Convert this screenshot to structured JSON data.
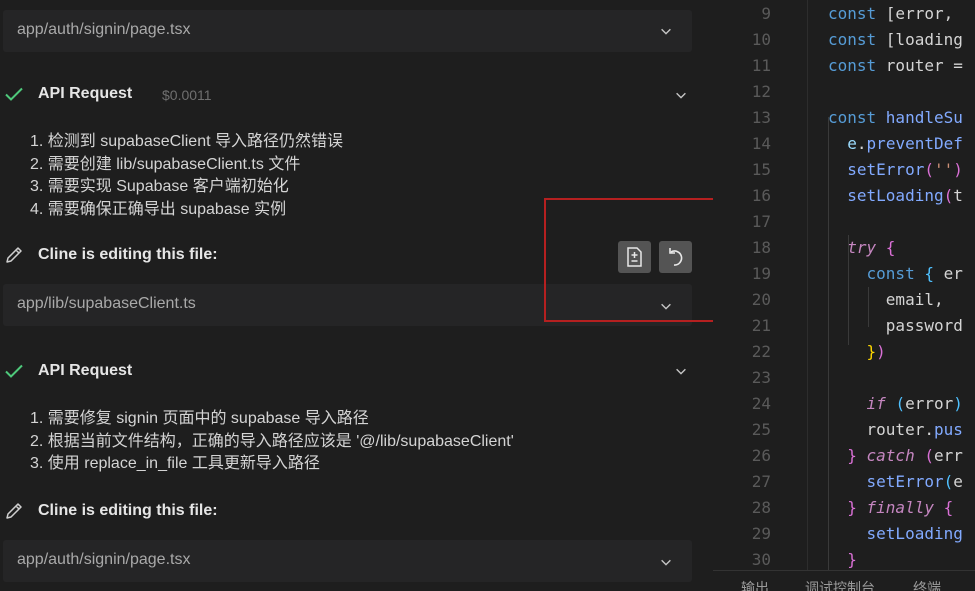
{
  "chat": {
    "top_file": {
      "path": "app/auth/signin/page.tsx"
    },
    "request_1": {
      "title": "API Request",
      "cost": "$0.0011",
      "steps": [
        "1. 检测到 supabaseClient 导入路径仍然错误",
        "2. 需要创建 lib/supabaseClient.ts 文件",
        "3. 需要实现 Supabase 客户端初始化",
        "4. 需要确保正确导出 supabase 实例"
      ]
    },
    "edit_1": {
      "label": "Cline is editing this file:",
      "path": "app/lib/supabaseClient.ts"
    },
    "request_2": {
      "title": "API Request",
      "steps": [
        "1. 需要修复 signin 页面中的 supabase 导入路径",
        "2. 根据当前文件结构，正确的导入路径应该是 '@/lib/supabaseClient'",
        "3. 使用 replace_in_file 工具更新导入路径"
      ]
    },
    "edit_2": {
      "label": "Cline is editing this file:",
      "path": "app/auth/signin/page.tsx"
    },
    "icons": {
      "check": "check-icon",
      "pencil": "pencil-icon",
      "chevron": "chevron-down-icon",
      "diff": "file-diff-icon",
      "undo": "undo-icon"
    }
  },
  "editor": {
    "lines": [
      {
        "n": "9",
        "tokens": [
          [
            "st",
            "const "
          ],
          [
            "pl",
            "[error, "
          ]
        ]
      },
      {
        "n": "10",
        "tokens": [
          [
            "st",
            "const "
          ],
          [
            "pl",
            "[loading"
          ]
        ]
      },
      {
        "n": "11",
        "tokens": [
          [
            "st",
            "const "
          ],
          [
            "pl",
            "router ="
          ]
        ]
      },
      {
        "n": "12",
        "tokens": []
      },
      {
        "n": "13",
        "tokens": [
          [
            "st",
            "const "
          ],
          [
            "fn",
            "handleSu"
          ]
        ]
      },
      {
        "n": "14",
        "tokens": [
          [
            "pr",
            "  e"
          ],
          [
            "pl",
            "."
          ],
          [
            "fn",
            "preventDef"
          ]
        ]
      },
      {
        "n": "15",
        "tokens": [
          [
            "fn",
            "  setError"
          ],
          [
            "br2",
            "("
          ],
          [
            "str",
            "''"
          ],
          [
            "br2",
            ")"
          ]
        ]
      },
      {
        "n": "16",
        "tokens": [
          [
            "fn",
            "  setLoading"
          ],
          [
            "br2",
            "("
          ],
          [
            "pl",
            "t"
          ]
        ]
      },
      {
        "n": "17",
        "tokens": []
      },
      {
        "n": "18",
        "tokens": [
          [
            "kw",
            "  try "
          ],
          [
            "br2",
            "{"
          ]
        ]
      },
      {
        "n": "19",
        "tokens": [
          [
            "st",
            "    const "
          ],
          [
            "br3",
            "{ "
          ],
          [
            "pl",
            "er"
          ]
        ]
      },
      {
        "n": "20",
        "tokens": [
          [
            "pl",
            "      email,"
          ]
        ]
      },
      {
        "n": "21",
        "tokens": [
          [
            "pl",
            "      password"
          ]
        ]
      },
      {
        "n": "22",
        "tokens": [
          [
            "br1",
            "    }"
          ],
          [
            "br2",
            ")"
          ]
        ]
      },
      {
        "n": "23",
        "tokens": []
      },
      {
        "n": "24",
        "tokens": [
          [
            "kw",
            "    if "
          ],
          [
            "br3",
            "("
          ],
          [
            "pl",
            "error"
          ],
          [
            "br3",
            ")"
          ]
        ]
      },
      {
        "n": "25",
        "tokens": [
          [
            "pl",
            "    router."
          ],
          [
            "fn",
            "pus"
          ]
        ]
      },
      {
        "n": "26",
        "tokens": [
          [
            "br2",
            "  } "
          ],
          [
            "kw",
            "catch "
          ],
          [
            "br2",
            "("
          ],
          [
            "pl",
            "err"
          ]
        ]
      },
      {
        "n": "27",
        "tokens": [
          [
            "fn",
            "    setError"
          ],
          [
            "br3",
            "("
          ],
          [
            "pl",
            "e"
          ]
        ]
      },
      {
        "n": "28",
        "tokens": [
          [
            "br2",
            "  } "
          ],
          [
            "kw",
            "finally "
          ],
          [
            "br2",
            "{"
          ]
        ]
      },
      {
        "n": "29",
        "tokens": [
          [
            "fn",
            "    setLoading"
          ]
        ]
      },
      {
        "n": "30",
        "tokens": [
          [
            "br2",
            "  }"
          ]
        ]
      }
    ],
    "bottom_tabs": [
      "输出",
      "调试控制台",
      "终端"
    ]
  },
  "colors": {
    "highlight_border": "#b52020",
    "check": "#4ec97b",
    "panel": "#252526"
  }
}
